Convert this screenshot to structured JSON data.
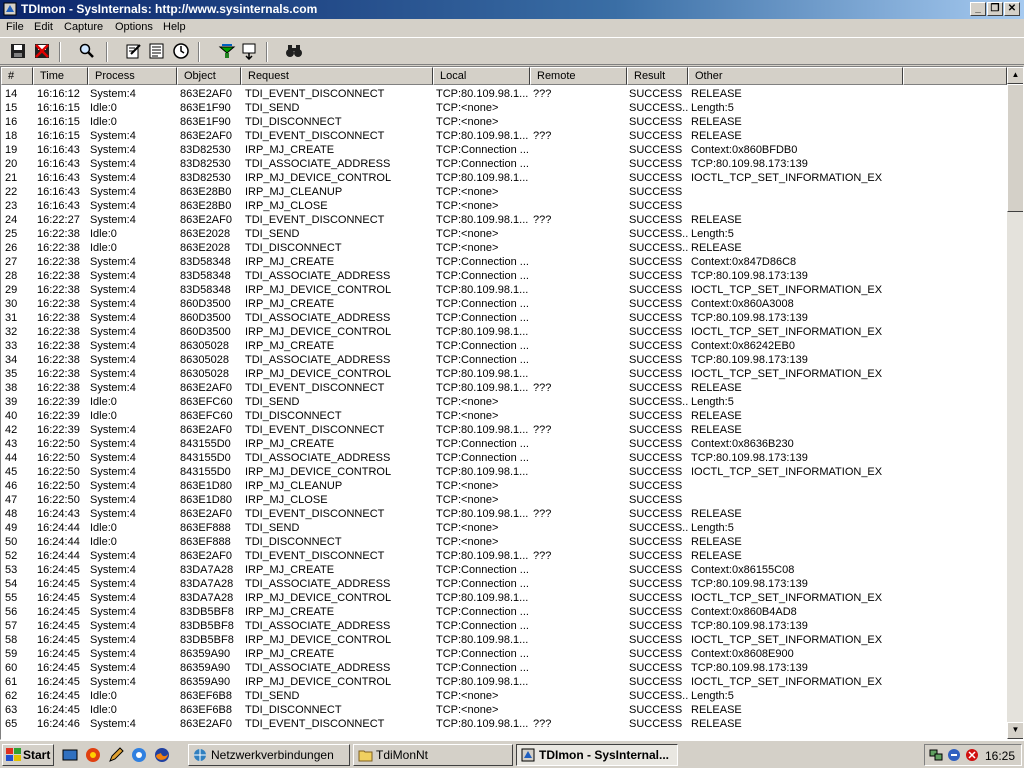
{
  "window": {
    "title": "TDImon - SysInternals: http://www.sysinternals.com"
  },
  "menu": [
    "File",
    "Edit",
    "Capture",
    "Options",
    "Help"
  ],
  "toolbar": {
    "icons": [
      "save-icon",
      "clear-icon",
      "find-icon",
      "edit-filter-icon",
      "history-icon",
      "clock-icon",
      "capture-icon",
      "autoscroll-icon",
      "binoculars-icon"
    ]
  },
  "columns": [
    "#",
    "Time",
    "Process",
    "Object",
    "Request",
    "Local",
    "Remote",
    "Result",
    "Other"
  ],
  "rows": [
    [
      "14",
      "16:16:12",
      "System:4",
      "863E2AF0",
      "TDI_EVENT_DISCONNECT",
      "TCP:80.109.98.1...",
      "???",
      "SUCCESS",
      "RELEASE"
    ],
    [
      "15",
      "16:16:15",
      "Idle:0",
      "863E1F90",
      "TDI_SEND",
      "TCP:<none>",
      "",
      "SUCCESS...",
      "Length:5"
    ],
    [
      "16",
      "16:16:15",
      "Idle:0",
      "863E1F90",
      "TDI_DISCONNECT",
      "TCP:<none>",
      "",
      "SUCCESS",
      "RELEASE"
    ],
    [
      "18",
      "16:16:15",
      "System:4",
      "863E2AF0",
      "TDI_EVENT_DISCONNECT",
      "TCP:80.109.98.1...",
      "???",
      "SUCCESS",
      "RELEASE"
    ],
    [
      "19",
      "16:16:43",
      "System:4",
      "83D82530",
      "IRP_MJ_CREATE",
      "TCP:Connection ...",
      "",
      "SUCCESS",
      "Context:0x860BFDB0"
    ],
    [
      "20",
      "16:16:43",
      "System:4",
      "83D82530",
      "TDI_ASSOCIATE_ADDRESS",
      "TCP:Connection ...",
      "",
      "SUCCESS",
      "TCP:80.109.98.173:139"
    ],
    [
      "21",
      "16:16:43",
      "System:4",
      "83D82530",
      "IRP_MJ_DEVICE_CONTROL",
      "TCP:80.109.98.1...",
      "",
      "SUCCESS",
      "IOCTL_TCP_SET_INFORMATION_EX"
    ],
    [
      "22",
      "16:16:43",
      "System:4",
      "863E28B0",
      "IRP_MJ_CLEANUP",
      "TCP:<none>",
      "",
      "SUCCESS",
      ""
    ],
    [
      "23",
      "16:16:43",
      "System:4",
      "863E28B0",
      "IRP_MJ_CLOSE",
      "TCP:<none>",
      "",
      "SUCCESS",
      ""
    ],
    [
      "24",
      "16:22:27",
      "System:4",
      "863E2AF0",
      "TDI_EVENT_DISCONNECT",
      "TCP:80.109.98.1...",
      "???",
      "SUCCESS",
      "RELEASE"
    ],
    [
      "25",
      "16:22:38",
      "Idle:0",
      "863E2028",
      "TDI_SEND",
      "TCP:<none>",
      "",
      "SUCCESS...",
      "Length:5"
    ],
    [
      "26",
      "16:22:38",
      "Idle:0",
      "863E2028",
      "TDI_DISCONNECT",
      "TCP:<none>",
      "",
      "SUCCESS...",
      "RELEASE"
    ],
    [
      "27",
      "16:22:38",
      "System:4",
      "83D58348",
      "IRP_MJ_CREATE",
      "TCP:Connection ...",
      "",
      "SUCCESS",
      "Context:0x847D86C8"
    ],
    [
      "28",
      "16:22:38",
      "System:4",
      "83D58348",
      "TDI_ASSOCIATE_ADDRESS",
      "TCP:Connection ...",
      "",
      "SUCCESS",
      "TCP:80.109.98.173:139"
    ],
    [
      "29",
      "16:22:38",
      "System:4",
      "83D58348",
      "IRP_MJ_DEVICE_CONTROL",
      "TCP:80.109.98.1...",
      "",
      "SUCCESS",
      "IOCTL_TCP_SET_INFORMATION_EX"
    ],
    [
      "30",
      "16:22:38",
      "System:4",
      "860D3500",
      "IRP_MJ_CREATE",
      "TCP:Connection ...",
      "",
      "SUCCESS",
      "Context:0x860A3008"
    ],
    [
      "31",
      "16:22:38",
      "System:4",
      "860D3500",
      "TDI_ASSOCIATE_ADDRESS",
      "TCP:Connection ...",
      "",
      "SUCCESS",
      "TCP:80.109.98.173:139"
    ],
    [
      "32",
      "16:22:38",
      "System:4",
      "860D3500",
      "IRP_MJ_DEVICE_CONTROL",
      "TCP:80.109.98.1...",
      "",
      "SUCCESS",
      "IOCTL_TCP_SET_INFORMATION_EX"
    ],
    [
      "33",
      "16:22:38",
      "System:4",
      "86305028",
      "IRP_MJ_CREATE",
      "TCP:Connection ...",
      "",
      "SUCCESS",
      "Context:0x86242EB0"
    ],
    [
      "34",
      "16:22:38",
      "System:4",
      "86305028",
      "TDI_ASSOCIATE_ADDRESS",
      "TCP:Connection ...",
      "",
      "SUCCESS",
      "TCP:80.109.98.173:139"
    ],
    [
      "35",
      "16:22:38",
      "System:4",
      "86305028",
      "IRP_MJ_DEVICE_CONTROL",
      "TCP:80.109.98.1...",
      "",
      "SUCCESS",
      "IOCTL_TCP_SET_INFORMATION_EX"
    ],
    [
      "38",
      "16:22:38",
      "System:4",
      "863E2AF0",
      "TDI_EVENT_DISCONNECT",
      "TCP:80.109.98.1...",
      "???",
      "SUCCESS",
      "RELEASE"
    ],
    [
      "39",
      "16:22:39",
      "Idle:0",
      "863EFC60",
      "TDI_SEND",
      "TCP:<none>",
      "",
      "SUCCESS...",
      "Length:5"
    ],
    [
      "40",
      "16:22:39",
      "Idle:0",
      "863EFC60",
      "TDI_DISCONNECT",
      "TCP:<none>",
      "",
      "SUCCESS",
      "RELEASE"
    ],
    [
      "42",
      "16:22:39",
      "System:4",
      "863E2AF0",
      "TDI_EVENT_DISCONNECT",
      "TCP:80.109.98.1...",
      "???",
      "SUCCESS",
      "RELEASE"
    ],
    [
      "43",
      "16:22:50",
      "System:4",
      "843155D0",
      "IRP_MJ_CREATE",
      "TCP:Connection ...",
      "",
      "SUCCESS",
      "Context:0x8636B230"
    ],
    [
      "44",
      "16:22:50",
      "System:4",
      "843155D0",
      "TDI_ASSOCIATE_ADDRESS",
      "TCP:Connection ...",
      "",
      "SUCCESS",
      "TCP:80.109.98.173:139"
    ],
    [
      "45",
      "16:22:50",
      "System:4",
      "843155D0",
      "IRP_MJ_DEVICE_CONTROL",
      "TCP:80.109.98.1...",
      "",
      "SUCCESS",
      "IOCTL_TCP_SET_INFORMATION_EX"
    ],
    [
      "46",
      "16:22:50",
      "System:4",
      "863E1D80",
      "IRP_MJ_CLEANUP",
      "TCP:<none>",
      "",
      "SUCCESS",
      ""
    ],
    [
      "47",
      "16:22:50",
      "System:4",
      "863E1D80",
      "IRP_MJ_CLOSE",
      "TCP:<none>",
      "",
      "SUCCESS",
      ""
    ],
    [
      "48",
      "16:24:43",
      "System:4",
      "863E2AF0",
      "TDI_EVENT_DISCONNECT",
      "TCP:80.109.98.1...",
      "???",
      "SUCCESS",
      "RELEASE"
    ],
    [
      "49",
      "16:24:44",
      "Idle:0",
      "863EF888",
      "TDI_SEND",
      "TCP:<none>",
      "",
      "SUCCESS...",
      "Length:5"
    ],
    [
      "50",
      "16:24:44",
      "Idle:0",
      "863EF888",
      "TDI_DISCONNECT",
      "TCP:<none>",
      "",
      "SUCCESS",
      "RELEASE"
    ],
    [
      "52",
      "16:24:44",
      "System:4",
      "863E2AF0",
      "TDI_EVENT_DISCONNECT",
      "TCP:80.109.98.1...",
      "???",
      "SUCCESS",
      "RELEASE"
    ],
    [
      "53",
      "16:24:45",
      "System:4",
      "83DA7A28",
      "IRP_MJ_CREATE",
      "TCP:Connection ...",
      "",
      "SUCCESS",
      "Context:0x86155C08"
    ],
    [
      "54",
      "16:24:45",
      "System:4",
      "83DA7A28",
      "TDI_ASSOCIATE_ADDRESS",
      "TCP:Connection ...",
      "",
      "SUCCESS",
      "TCP:80.109.98.173:139"
    ],
    [
      "55",
      "16:24:45",
      "System:4",
      "83DA7A28",
      "IRP_MJ_DEVICE_CONTROL",
      "TCP:80.109.98.1...",
      "",
      "SUCCESS",
      "IOCTL_TCP_SET_INFORMATION_EX"
    ],
    [
      "56",
      "16:24:45",
      "System:4",
      "83DB5BF8",
      "IRP_MJ_CREATE",
      "TCP:Connection ...",
      "",
      "SUCCESS",
      "Context:0x860B4AD8"
    ],
    [
      "57",
      "16:24:45",
      "System:4",
      "83DB5BF8",
      "TDI_ASSOCIATE_ADDRESS",
      "TCP:Connection ...",
      "",
      "SUCCESS",
      "TCP:80.109.98.173:139"
    ],
    [
      "58",
      "16:24:45",
      "System:4",
      "83DB5BF8",
      "IRP_MJ_DEVICE_CONTROL",
      "TCP:80.109.98.1...",
      "",
      "SUCCESS",
      "IOCTL_TCP_SET_INFORMATION_EX"
    ],
    [
      "59",
      "16:24:45",
      "System:4",
      "86359A90",
      "IRP_MJ_CREATE",
      "TCP:Connection ...",
      "",
      "SUCCESS",
      "Context:0x8608E900"
    ],
    [
      "60",
      "16:24:45",
      "System:4",
      "86359A90",
      "TDI_ASSOCIATE_ADDRESS",
      "TCP:Connection ...",
      "",
      "SUCCESS",
      "TCP:80.109.98.173:139"
    ],
    [
      "61",
      "16:24:45",
      "System:4",
      "86359A90",
      "IRP_MJ_DEVICE_CONTROL",
      "TCP:80.109.98.1...",
      "",
      "SUCCESS",
      "IOCTL_TCP_SET_INFORMATION_EX"
    ],
    [
      "62",
      "16:24:45",
      "Idle:0",
      "863EF6B8",
      "TDI_SEND",
      "TCP:<none>",
      "",
      "SUCCESS...",
      "Length:5"
    ],
    [
      "63",
      "16:24:45",
      "Idle:0",
      "863EF6B8",
      "TDI_DISCONNECT",
      "TCP:<none>",
      "",
      "SUCCESS",
      "RELEASE"
    ],
    [
      "65",
      "16:24:46",
      "System:4",
      "863E2AF0",
      "TDI_EVENT_DISCONNECT",
      "TCP:80.109.98.1...",
      "???",
      "SUCCESS",
      "RELEASE"
    ]
  ],
  "taskbar": {
    "start_label": "Start",
    "tasks": [
      "Netzwerkverbindungen",
      "TdiMonNt",
      "TDImon - SysInternal..."
    ],
    "clock": "16:25"
  },
  "colors": {
    "title_active": "#0a246a",
    "face": "#d4d0c8"
  }
}
